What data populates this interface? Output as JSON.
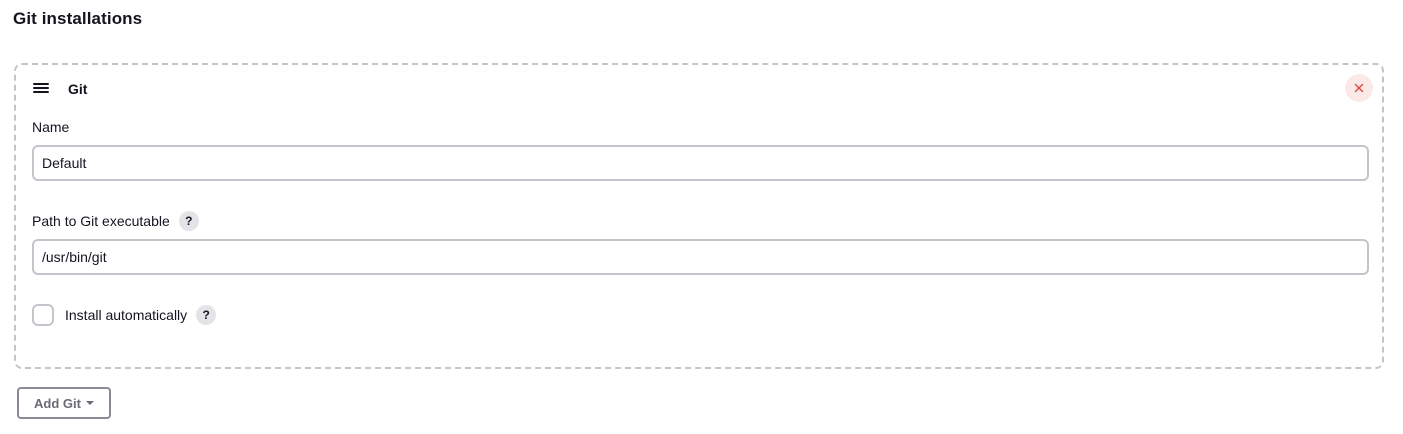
{
  "page": {
    "title": "Git installations"
  },
  "card": {
    "title": "Git",
    "drag_icon": "drag-handle-icon",
    "delete_icon": "close-icon",
    "delete_color": "#e0493b"
  },
  "fields": {
    "name": {
      "label": "Name",
      "value": "Default"
    },
    "path": {
      "label": "Path to Git executable",
      "value": "/usr/bin/git",
      "help": "?"
    },
    "install": {
      "label": "Install automatically",
      "checked": false,
      "help": "?"
    }
  },
  "actions": {
    "add_label": "Add Git",
    "add_icon": "caret-down-icon"
  }
}
